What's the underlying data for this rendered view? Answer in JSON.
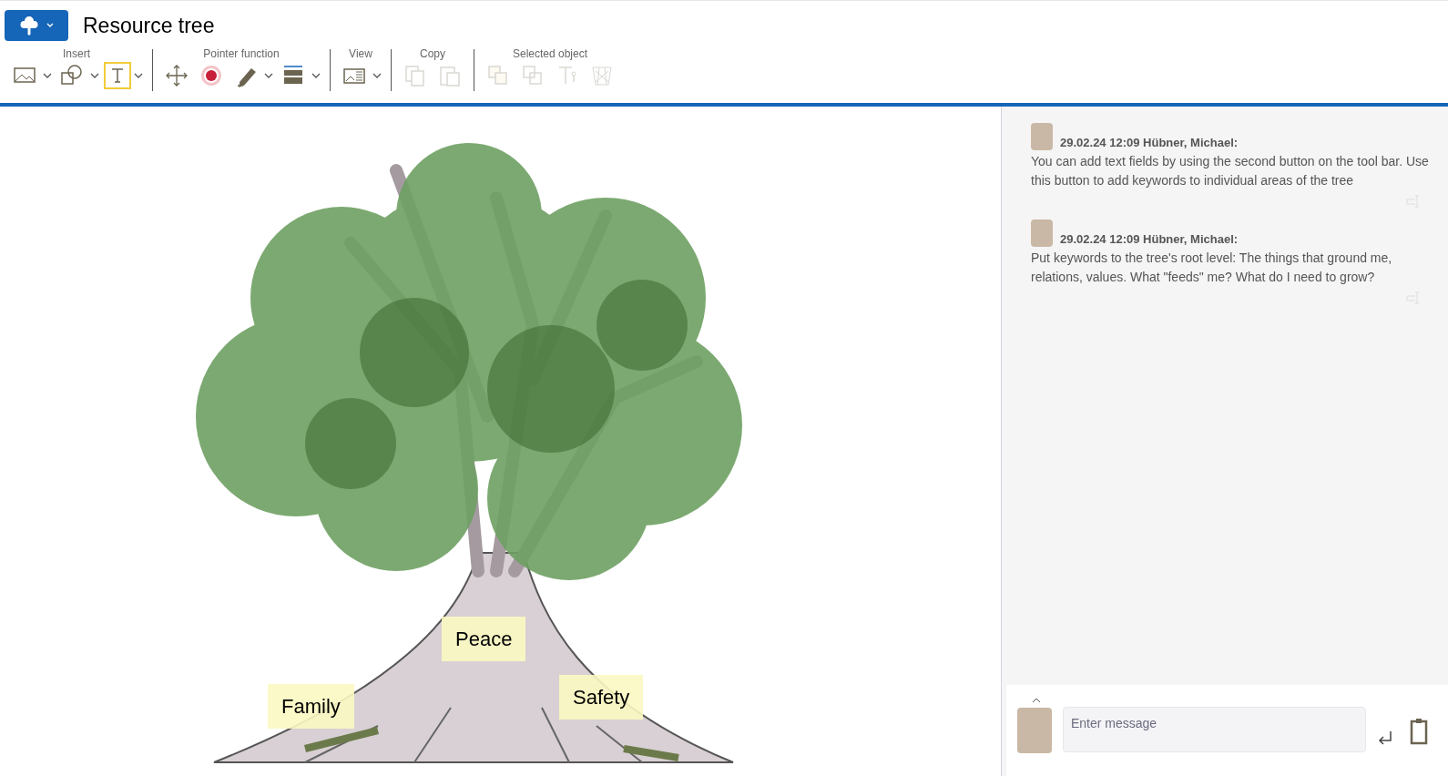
{
  "title": "Resource tree",
  "toolbar": [
    {
      "label": "Insert",
      "tools": [
        {
          "kind": "image",
          "dropdown": true,
          "disabled": false,
          "selected": false
        },
        {
          "kind": "shapes",
          "dropdown": true,
          "disabled": false,
          "selected": false
        },
        {
          "kind": "text",
          "dropdown": true,
          "disabled": false,
          "selected": true
        }
      ]
    },
    {
      "label": "Pointer function",
      "tools": [
        {
          "kind": "move",
          "dropdown": false,
          "disabled": false,
          "selected": false
        },
        {
          "kind": "pointer",
          "dropdown": false,
          "disabled": false,
          "selected": false
        },
        {
          "kind": "pen",
          "dropdown": true,
          "disabled": false,
          "selected": false
        },
        {
          "kind": "line",
          "dropdown": true,
          "disabled": false,
          "selected": false
        }
      ]
    },
    {
      "label": "View",
      "tools": [
        {
          "kind": "view",
          "dropdown": true,
          "disabled": false,
          "selected": false
        }
      ]
    },
    {
      "label": "Copy",
      "tools": [
        {
          "kind": "copy",
          "dropdown": false,
          "disabled": true,
          "selected": false
        },
        {
          "kind": "paste",
          "dropdown": false,
          "disabled": true,
          "selected": false
        }
      ]
    },
    {
      "label": "Selected object",
      "tools": [
        {
          "kind": "front",
          "dropdown": false,
          "disabled": true,
          "selected": false
        },
        {
          "kind": "back",
          "dropdown": false,
          "disabled": true,
          "selected": false
        },
        {
          "kind": "textedit",
          "dropdown": false,
          "disabled": true,
          "selected": false
        },
        {
          "kind": "delete",
          "dropdown": false,
          "disabled": true,
          "selected": false
        }
      ]
    }
  ],
  "canvas_labels": [
    "Peace",
    "Family",
    "Safety"
  ],
  "messages": [
    {
      "header": "29.02.24 12:09 Hübner, Michael:",
      "text": "You can add text fields by using the second button on the tool bar. Use this button to add keywords to individual areas of the tree"
    },
    {
      "header": "29.02.24 12:09 Hübner, Michael:",
      "text": "Put keywords to the tree's root level: The things that ground me, relations, values. What \"feeds\" me? What do I need to grow?"
    }
  ],
  "composer": {
    "placeholder": "Enter message"
  }
}
